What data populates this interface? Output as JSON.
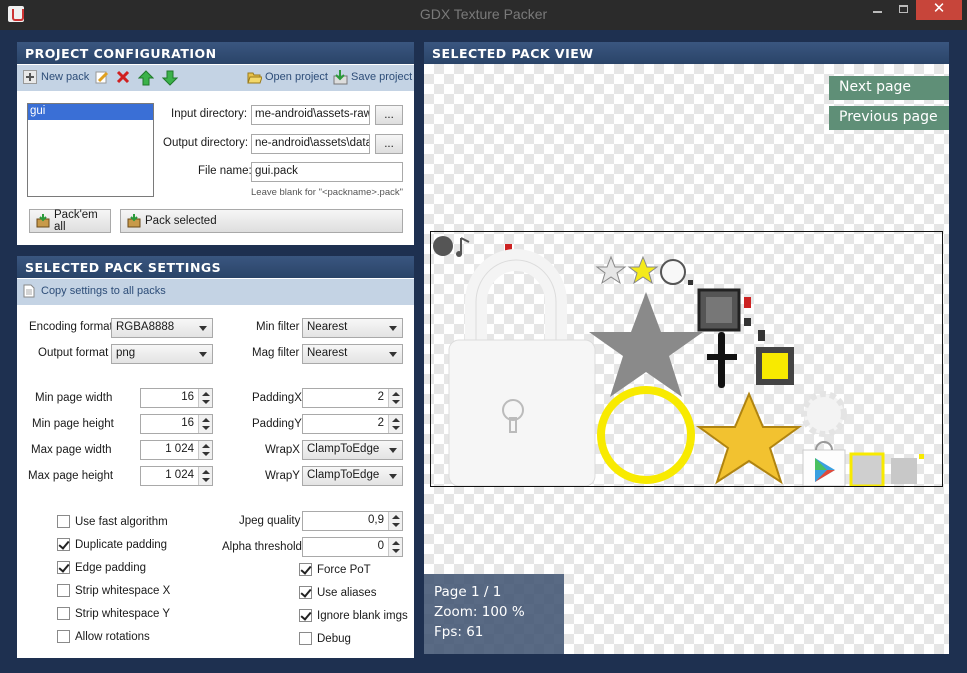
{
  "window": {
    "title": "GDX Texture Packer"
  },
  "project": {
    "header": "Project configuration",
    "toolbar": {
      "new_pack": "New pack",
      "open_project": "Open project",
      "save_project": "Save project"
    },
    "packs": [
      "gui"
    ],
    "input_dir_label": "Input directory:",
    "input_dir_value": "me-android\\assets-raw",
    "output_dir_label": "Output directory:",
    "output_dir_value": "ne-android\\assets\\data",
    "browse_label": "...",
    "filename_label": "File name:",
    "filename_value": "gui.pack",
    "filename_hint": "Leave blank for \"<packname>.pack\"",
    "pack_all": "Pack'em all",
    "pack_selected": "Pack selected"
  },
  "settings": {
    "header": "Selected pack settings",
    "copy_settings": "Copy settings to all packs",
    "encoding_format_label": "Encoding format",
    "encoding_format_value": "RGBA8888",
    "output_format_label": "Output format",
    "output_format_value": "png",
    "min_filter_label": "Min filter",
    "min_filter_value": "Nearest",
    "mag_filter_label": "Mag filter",
    "mag_filter_value": "Nearest",
    "min_page_width_label": "Min page width",
    "min_page_width_value": "16",
    "min_page_height_label": "Min page height",
    "min_page_height_value": "16",
    "max_page_width_label": "Max page width",
    "max_page_width_value": "1 024",
    "max_page_height_label": "Max page height",
    "max_page_height_value": "1 024",
    "padding_x_label": "PaddingX",
    "padding_x_value": "2",
    "padding_y_label": "PaddingY",
    "padding_y_value": "2",
    "wrap_x_label": "WrapX",
    "wrap_x_value": "ClampToEdge",
    "wrap_y_label": "WrapY",
    "wrap_y_value": "ClampToEdge",
    "jpeg_quality_label": "Jpeg quality",
    "jpeg_quality_value": "0,9",
    "alpha_threshold_label": "Alpha threshold",
    "alpha_threshold_value": "0",
    "checks": {
      "use_fast_algorithm": {
        "label": "Use fast algorithm",
        "checked": false
      },
      "duplicate_padding": {
        "label": "Duplicate padding",
        "checked": true
      },
      "edge_padding": {
        "label": "Edge padding",
        "checked": true
      },
      "strip_whitespace_x": {
        "label": "Strip whitespace X",
        "checked": false
      },
      "strip_whitespace_y": {
        "label": "Strip whitespace Y",
        "checked": false
      },
      "allow_rotations": {
        "label": "Allow rotations",
        "checked": false
      },
      "force_pot": {
        "label": "Force PoT",
        "checked": true
      },
      "use_aliases": {
        "label": "Use aliases",
        "checked": true
      },
      "ignore_blank_imgs": {
        "label": "Ignore blank imgs",
        "checked": true
      },
      "debug": {
        "label": "Debug",
        "checked": false
      }
    }
  },
  "view": {
    "header": "Selected pack view",
    "next_page": "Next page",
    "previous_page": "Previous page",
    "page": "Page 1 / 1",
    "zoom": "Zoom: 100 %",
    "fps": "Fps: 61"
  },
  "colors": {
    "panel_header": "#2f4a72",
    "toolbar_strip": "#c4d3e4",
    "page_button": "#5f8f77",
    "selection": "#3a6fd6"
  }
}
